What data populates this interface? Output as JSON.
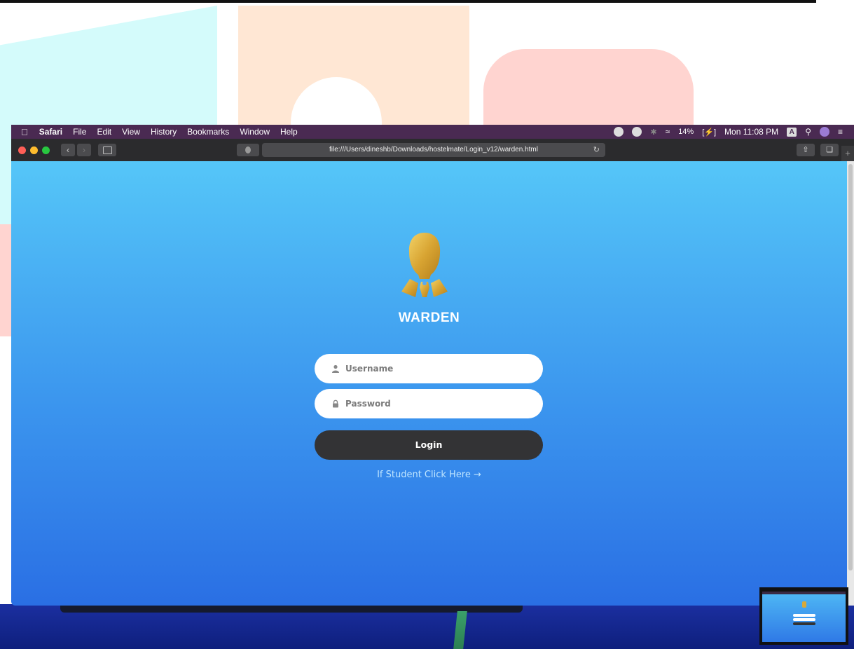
{
  "menubar": {
    "app_name": "Safari",
    "items": [
      "File",
      "Edit",
      "View",
      "History",
      "Bookmarks",
      "Window",
      "Help"
    ],
    "battery": "14%",
    "clock": "Mon 11:08 PM",
    "input_badge": "A"
  },
  "toolbar": {
    "url": "file:///Users/dineshb/Downloads/hostelmate/Login_v12/warden.html"
  },
  "login": {
    "title": "WARDEN",
    "username_placeholder": "Username",
    "password_placeholder": "Password",
    "login_label": "Login",
    "student_link": "If Student Click Here →"
  },
  "colors": {
    "gradient_top": "#55c6f8",
    "gradient_bottom": "#2a6fe4",
    "button_dark": "#333335",
    "menubar": "#4a2a52"
  }
}
